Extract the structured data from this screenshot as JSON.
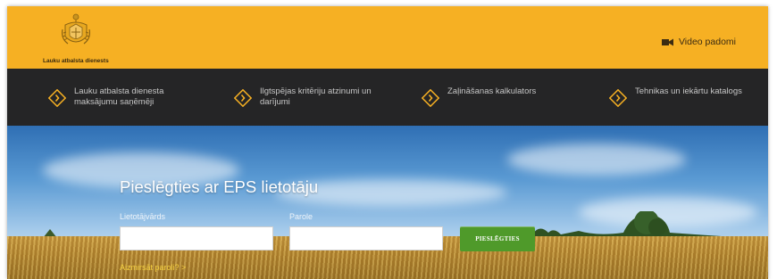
{
  "header": {
    "logo_text": "Lauku atbalsta dienests",
    "video_link": "Video padomi",
    "background": "#f6b023"
  },
  "nav": {
    "items": [
      {
        "label": "Lauku atbalsta dienesta maksājumu saņēmēji",
        "icon": "chevron-right-diamond-icon"
      },
      {
        "label": "Ilgtspējas kritēriju atzinumi un darījumi",
        "icon": "chevron-right-diamond-icon"
      },
      {
        "label": "Zaļināšanas kalkulators",
        "icon": "chevron-right-diamond-icon"
      },
      {
        "label": "Tehnikas un iekārtu katalogs",
        "icon": "chevron-right-diamond-icon"
      }
    ],
    "background": "#252526"
  },
  "login": {
    "title": "Pieslēgties ar EPS lietotāju",
    "username_label": "Lietotājvārds",
    "username_value": "",
    "password_label": "Parole",
    "password_value": "",
    "submit_label": "PIESLĒGTIES",
    "forgot_link": "Aizmirsāt paroli? >",
    "button_color": "#4f9a2a"
  }
}
